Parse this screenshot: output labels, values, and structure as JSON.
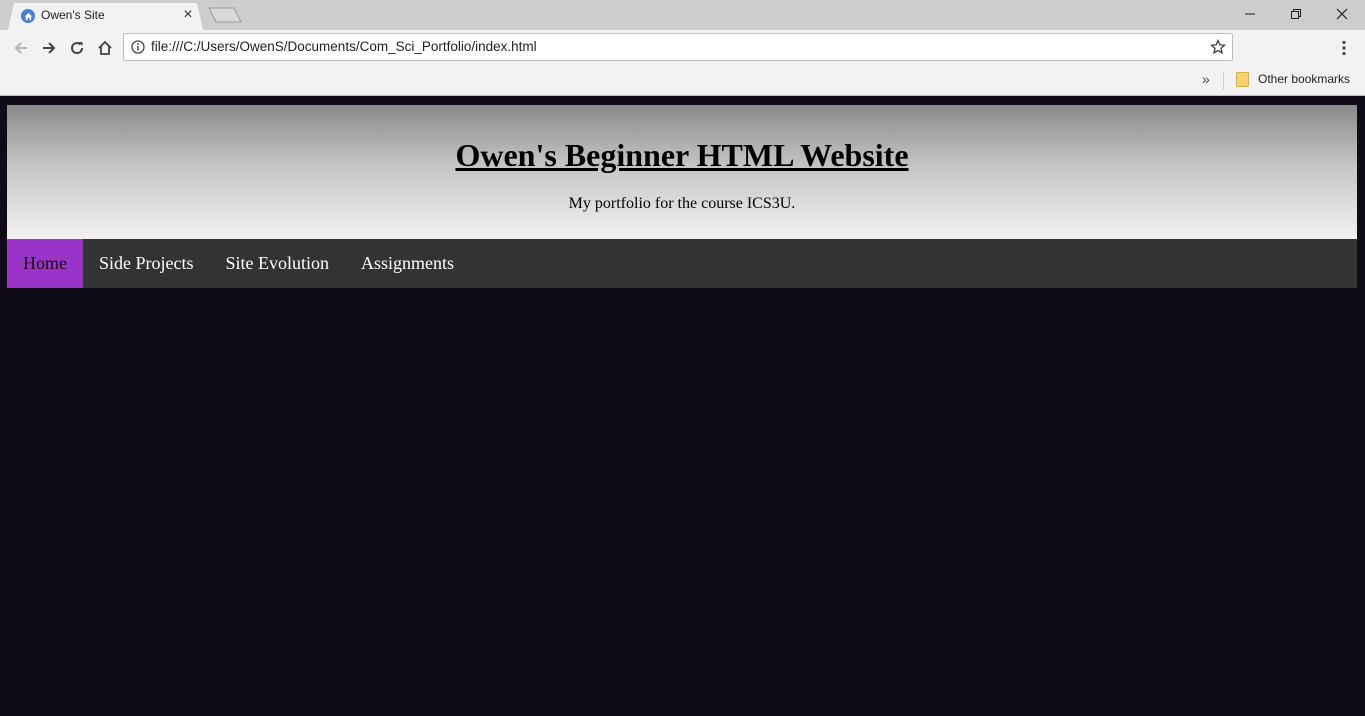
{
  "browser": {
    "tab": {
      "title": "Owen's Site",
      "close_label": "×",
      "favicon": "home-icon"
    },
    "address_bar": {
      "url": "file:///C:/Users/OwenS/Documents/Com_Sci_Portfolio/index.html"
    },
    "bookmarks_bar": {
      "overflow_label": "»",
      "folder_label": "Other bookmarks"
    },
    "colors": {
      "chrome": "#f2f2f2",
      "titlebar": "#cdcdcd",
      "favicon": "#4a7fd6",
      "folder": "#f6d26b"
    }
  },
  "page": {
    "header": {
      "title": "Owen's Beginner HTML Website",
      "subtitle": "My portfolio for the course ICS3U."
    },
    "nav": {
      "items": [
        {
          "label": "Home",
          "active": true
        },
        {
          "label": "Side Projects",
          "active": false
        },
        {
          "label": "Site Evolution",
          "active": false
        },
        {
          "label": "Assignments",
          "active": false
        }
      ]
    },
    "colors": {
      "background": "#0f0c17",
      "nav_bar": "#333333",
      "nav_active": "#9a34c9"
    }
  }
}
